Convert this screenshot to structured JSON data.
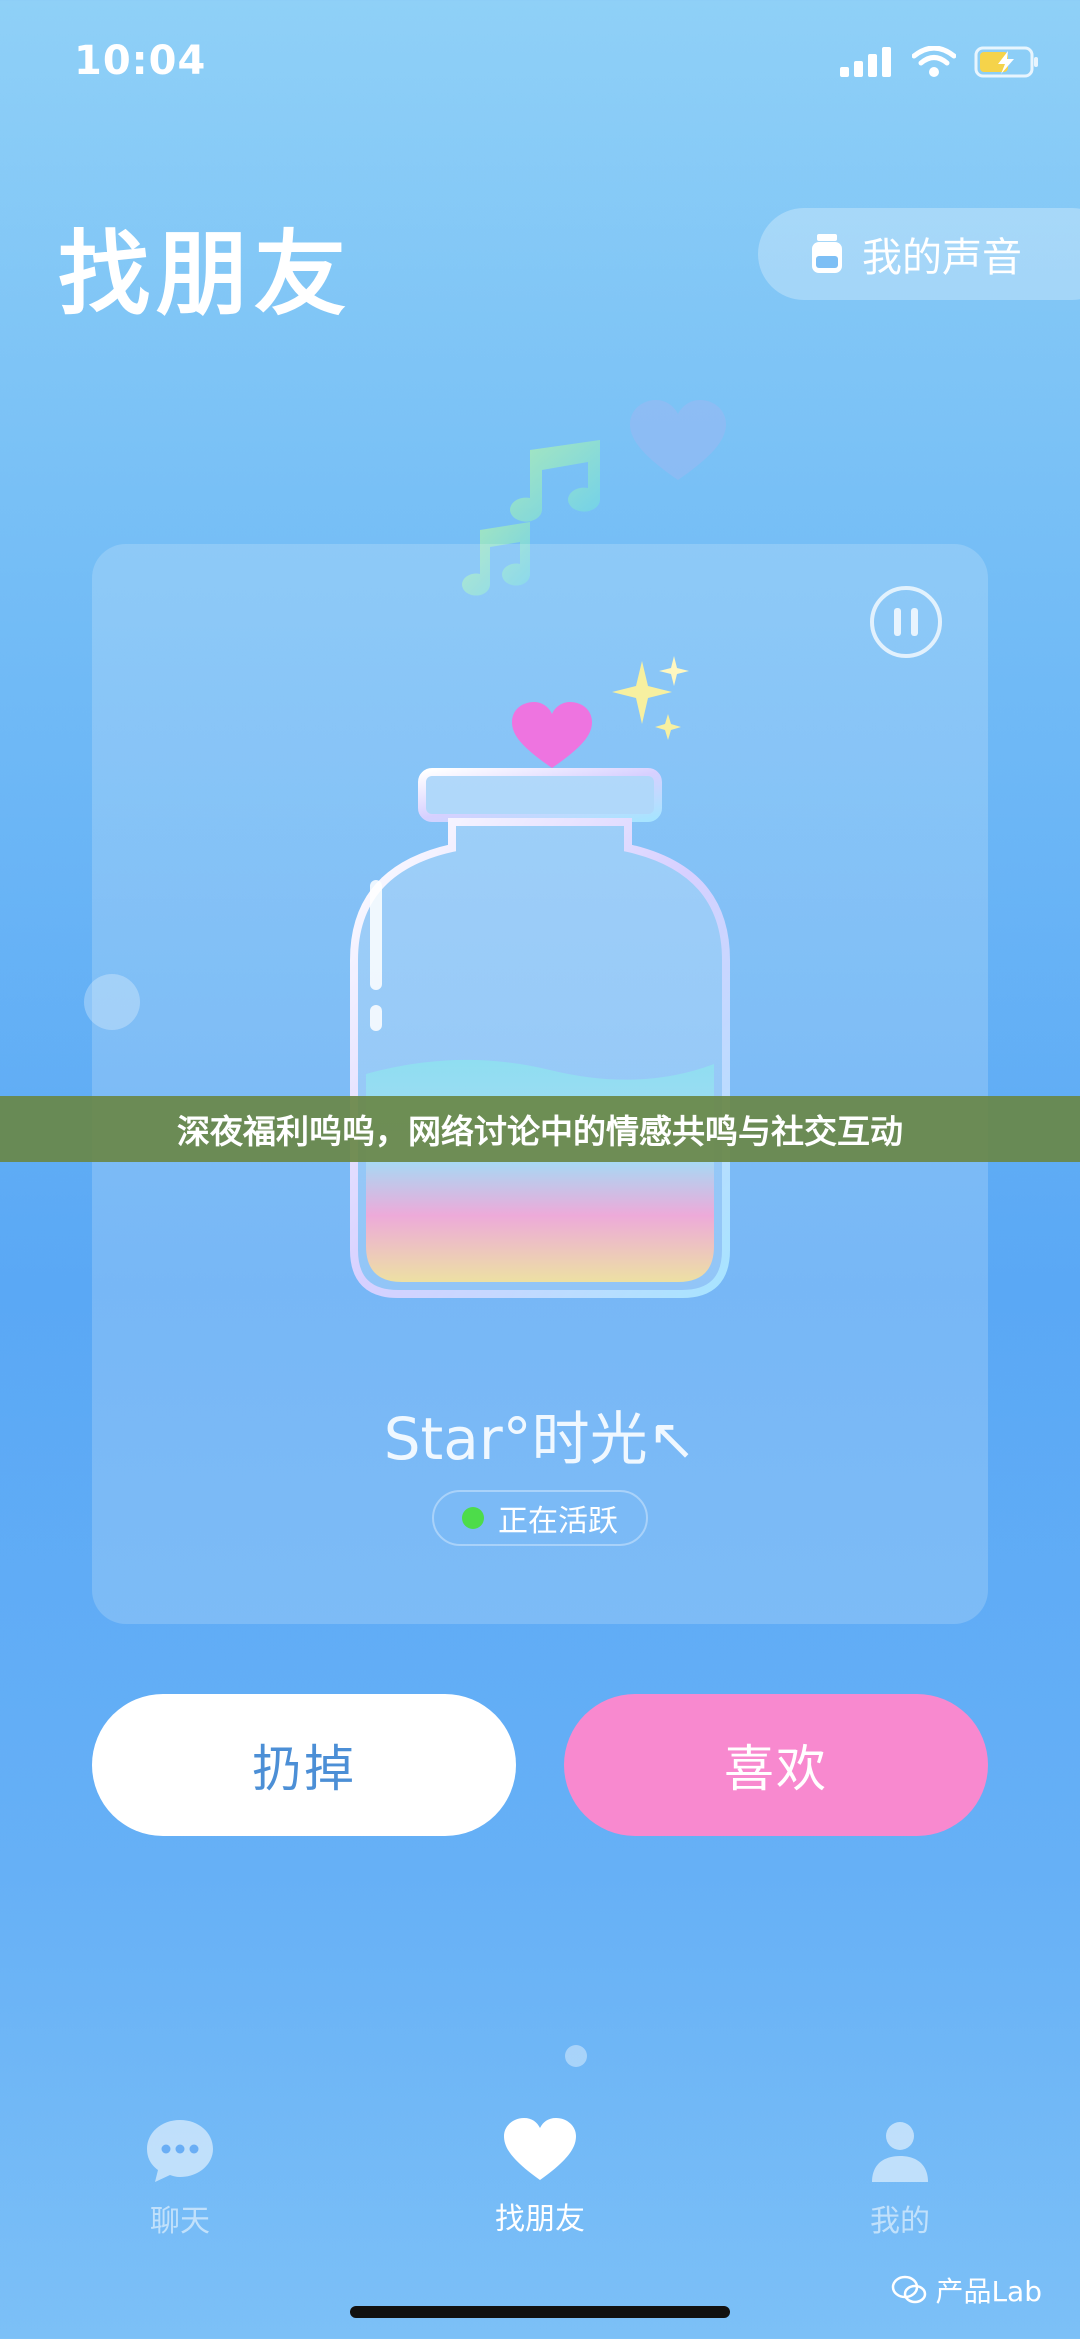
{
  "status_bar": {
    "time": "10:04"
  },
  "header": {
    "title": "找朋友",
    "voice_button_label": "我的声音"
  },
  "banner": {
    "text": "深夜福利呜呜，网络讨论中的情感共鸣与社交互动"
  },
  "card": {
    "username": "Star°时光↖",
    "status_text": "正在活跃",
    "status_color": "#4ddc4a"
  },
  "actions": {
    "discard_label": "扔掉",
    "like_label": "喜欢",
    "like_color": "#f889cf"
  },
  "tabbar": {
    "items": [
      {
        "label": "聊天",
        "icon": "chat-bubble-icon",
        "active": false
      },
      {
        "label": "找朋友",
        "icon": "heart-icon",
        "active": true
      },
      {
        "label": "我的",
        "icon": "person-icon",
        "active": false
      }
    ]
  },
  "watermark": {
    "text": "产品Lab"
  }
}
